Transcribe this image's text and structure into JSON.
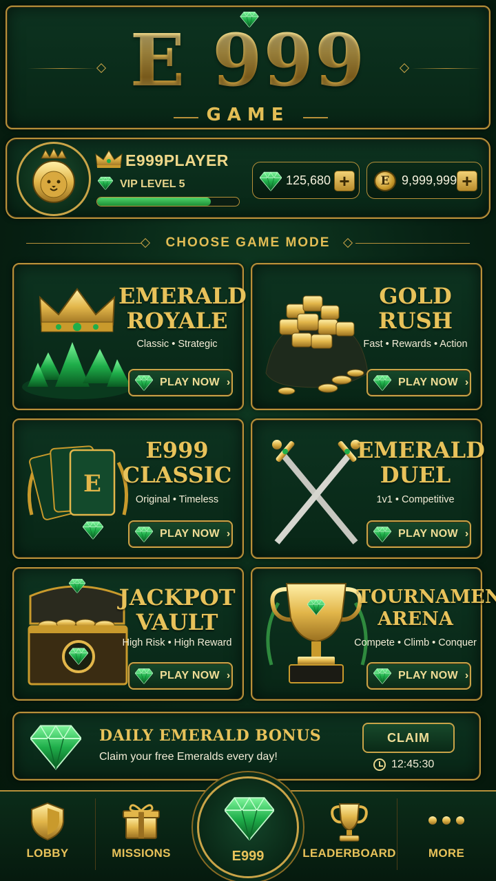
{
  "header": {
    "logo_main": "E 999",
    "logo_sub": "GAME"
  },
  "player": {
    "name": "E999PLAYER",
    "vip": "VIP LEVEL 5",
    "xp_progress": 0.8,
    "gems": "125,680",
    "coins": "9,999,999",
    "coin_symbol": "E"
  },
  "section": {
    "title": "CHOOSE GAME MODE"
  },
  "games": [
    {
      "title_1": "EMERALD",
      "title_2": "ROYALE",
      "tags": "Classic • Strategic",
      "button": "PLAY NOW"
    },
    {
      "title_1": "GOLD",
      "title_2": "RUSH",
      "tags": "Fast • Rewards • Action",
      "button": "PLAY NOW"
    },
    {
      "title_1": "E999",
      "title_2": "CLASSIC",
      "tags": "Original • Timeless",
      "button": "PLAY NOW"
    },
    {
      "title_1": "EMERALD",
      "title_2": "DUEL",
      "tags": "1v1 • Competitive",
      "button": "PLAY NOW"
    },
    {
      "title_1": "JACKPOT",
      "title_2": "VAULT",
      "tags": "High Risk • High Reward",
      "button": "PLAY NOW"
    },
    {
      "title_1": "TOURNAMENT",
      "title_2": "ARENA",
      "tags": "Compete • Climb • Conquer",
      "button": "PLAY NOW"
    }
  ],
  "daily": {
    "title": "DAILY EMERALD BONUS",
    "subtitle": "Claim your free Emeralds every day!",
    "button": "CLAIM",
    "timer": "12:45:30"
  },
  "nav": {
    "lobby": "LOBBY",
    "missions": "MISSIONS",
    "center": "E999",
    "leaderboard": "LEADERBOARD",
    "more": "MORE"
  },
  "colors": {
    "gold": "#e8c25a",
    "emerald": "#1fae4a",
    "background": "#072214"
  },
  "icons": [
    "emerald-icon",
    "crown-icon",
    "lion-avatar",
    "coin-icon",
    "plus-icon",
    "chevron-right-icon",
    "shield-icon",
    "gift-icon",
    "trophy-icon",
    "dots-icon",
    "clock-icon",
    "swords-icon",
    "cards-icon",
    "treasure-chest-icon",
    "gold-pile-icon"
  ]
}
